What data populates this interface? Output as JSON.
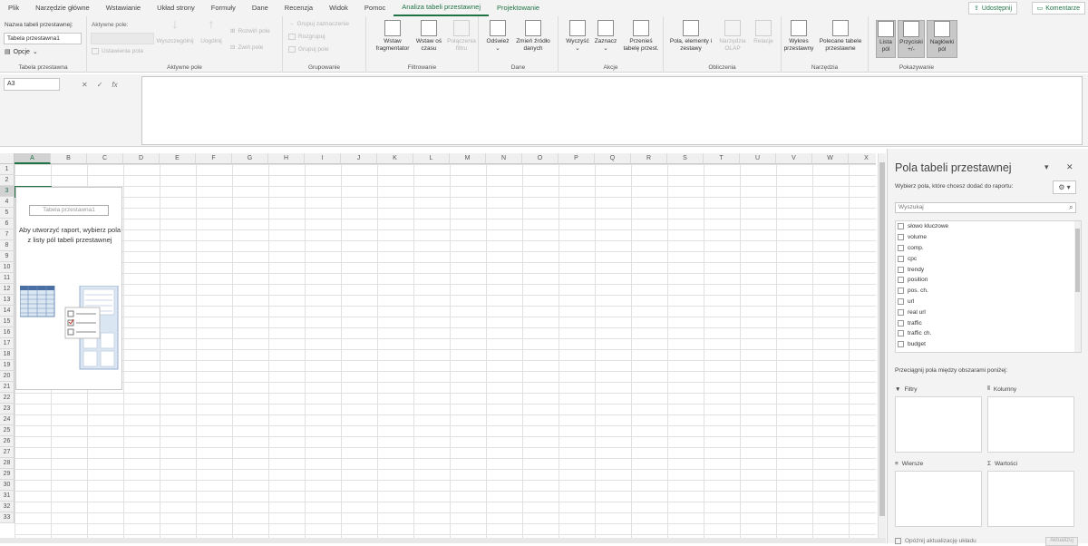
{
  "menu": {
    "tabs": [
      "Plik",
      "Narzędzie główne",
      "Wstawianie",
      "Układ strony",
      "Formuły",
      "Dane",
      "Recenzja",
      "Widok",
      "Pomoc",
      "Analiza tabeli przestawnej",
      "Projektowanie"
    ],
    "share": "Udostępnij",
    "comments": "Komentarze"
  },
  "ribbon": {
    "pivot_table": {
      "label": "Nazwa tabeli przestawnej:",
      "name_value": "Tabela przestawna1",
      "options": "Opcje",
      "group": "Tabela przestawna"
    },
    "active_field": {
      "label": "Aktywne pole:",
      "drill_down": "Wyszczególnij",
      "drill_up": "Uogólnij",
      "expand": "Rozwiń pole",
      "collapse": "Zwiń pole",
      "settings": "Ustawienia pola",
      "group": "Aktywne pole"
    },
    "grouping": {
      "sel": "Grupuj zaznaczenie",
      "ungroup": "Rozgrupuj",
      "field": "Grupuj pole",
      "group": "Grupowanie"
    },
    "filter": {
      "slicer": "Wstaw fragmentator",
      "timeline": "Wstaw oś czasu",
      "connections": "Połączenia filtru",
      "group": "Filtrowanie"
    },
    "data": {
      "refresh": "Odśwież",
      "change_source": "Zmień źródło danych",
      "group": "Dane"
    },
    "actions": {
      "clear": "Wyczyść",
      "select": "Zaznacz",
      "move": "Przenieś tabelę przest.",
      "group": "Akcje"
    },
    "calcs": {
      "fields": "Pola, elementy i zestawy",
      "olap": "Narzędzia OLAP",
      "relations": "Relacje",
      "group": "Obliczenia"
    },
    "tools": {
      "chart": "Wykres przestawny",
      "recommended": "Polecane tabele przestawne",
      "group": "Narzędzia"
    },
    "show": {
      "field_list": "Lista pól",
      "buttons": "Przyciski +/-",
      "headers": "Nagłówki pól",
      "group": "Pokazywanie"
    }
  },
  "formula_bar": {
    "name_box": "A3",
    "fx": "fx"
  },
  "grid": {
    "columns": [
      "A",
      "B",
      "C",
      "D",
      "E",
      "F",
      "G",
      "H",
      "I",
      "J",
      "K",
      "L",
      "M",
      "N",
      "O",
      "P",
      "Q",
      "R",
      "S",
      "T",
      "U",
      "V",
      "W",
      "X"
    ],
    "rows": [
      "1",
      "2",
      "3",
      "4",
      "5",
      "6",
      "7",
      "8",
      "9",
      "10",
      "11",
      "12",
      "13",
      "14",
      "15",
      "16",
      "17",
      "18",
      "19",
      "20",
      "21",
      "22",
      "23",
      "24",
      "25",
      "26",
      "27",
      "28",
      "29",
      "30",
      "31",
      "32",
      "33"
    ],
    "selected_col": "A",
    "selected_row": "3"
  },
  "placeholder": {
    "title": "Tabela przestawna1",
    "text": "Aby utworzyć raport, wybierz pola z listy pól tabeli przestawnej"
  },
  "pane": {
    "title": "Pola tabeli przestawnej",
    "subtitle": "Wybierz pola, które chcesz dodać do raportu:",
    "search_placeholder": "Wyszukaj",
    "fields": [
      "słowo kluczowe",
      "volume",
      "comp.",
      "cpc",
      "trendy",
      "position",
      "pos. ch.",
      "url",
      "real url",
      "traffic",
      "traffic ch.",
      "budget"
    ],
    "drag_text": "Przeciągnij pola między obszarami poniżej:",
    "areas": {
      "filters": "Filtry",
      "columns": "Kolumny",
      "rows": "Wiersze",
      "values": "Wartości"
    },
    "defer": "Opóźnij aktualizację układu",
    "update": "Aktualizuj"
  },
  "colors": {
    "accent": "#217346",
    "ribbon_bg": "#f3f3f3"
  }
}
